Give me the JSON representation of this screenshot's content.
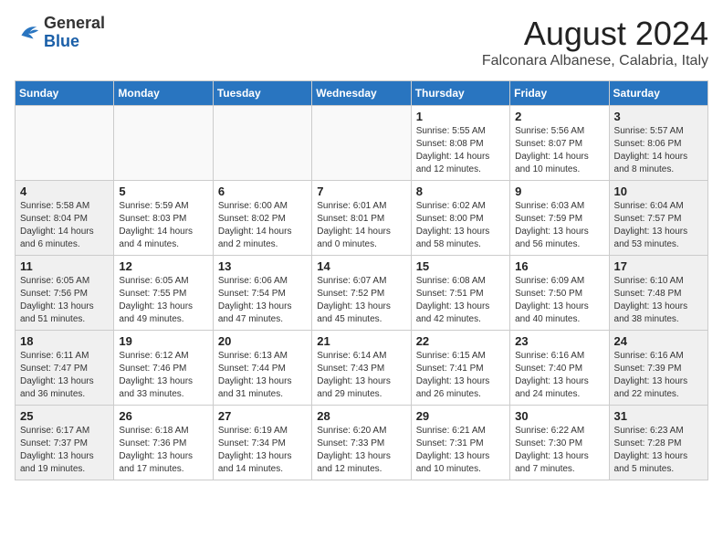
{
  "header": {
    "logo_general": "General",
    "logo_blue": "Blue",
    "month": "August 2024",
    "location": "Falconara Albanese, Calabria, Italy"
  },
  "days_of_week": [
    "Sunday",
    "Monday",
    "Tuesday",
    "Wednesday",
    "Thursday",
    "Friday",
    "Saturday"
  ],
  "weeks": [
    [
      {
        "day": "",
        "info": ""
      },
      {
        "day": "",
        "info": ""
      },
      {
        "day": "",
        "info": ""
      },
      {
        "day": "",
        "info": ""
      },
      {
        "day": "1",
        "info": "Sunrise: 5:55 AM\nSunset: 8:08 PM\nDaylight: 14 hours\nand 12 minutes."
      },
      {
        "day": "2",
        "info": "Sunrise: 5:56 AM\nSunset: 8:07 PM\nDaylight: 14 hours\nand 10 minutes."
      },
      {
        "day": "3",
        "info": "Sunrise: 5:57 AM\nSunset: 8:06 PM\nDaylight: 14 hours\nand 8 minutes."
      }
    ],
    [
      {
        "day": "4",
        "info": "Sunrise: 5:58 AM\nSunset: 8:04 PM\nDaylight: 14 hours\nand 6 minutes."
      },
      {
        "day": "5",
        "info": "Sunrise: 5:59 AM\nSunset: 8:03 PM\nDaylight: 14 hours\nand 4 minutes."
      },
      {
        "day": "6",
        "info": "Sunrise: 6:00 AM\nSunset: 8:02 PM\nDaylight: 14 hours\nand 2 minutes."
      },
      {
        "day": "7",
        "info": "Sunrise: 6:01 AM\nSunset: 8:01 PM\nDaylight: 14 hours\nand 0 minutes."
      },
      {
        "day": "8",
        "info": "Sunrise: 6:02 AM\nSunset: 8:00 PM\nDaylight: 13 hours\nand 58 minutes."
      },
      {
        "day": "9",
        "info": "Sunrise: 6:03 AM\nSunset: 7:59 PM\nDaylight: 13 hours\nand 56 minutes."
      },
      {
        "day": "10",
        "info": "Sunrise: 6:04 AM\nSunset: 7:57 PM\nDaylight: 13 hours\nand 53 minutes."
      }
    ],
    [
      {
        "day": "11",
        "info": "Sunrise: 6:05 AM\nSunset: 7:56 PM\nDaylight: 13 hours\nand 51 minutes."
      },
      {
        "day": "12",
        "info": "Sunrise: 6:05 AM\nSunset: 7:55 PM\nDaylight: 13 hours\nand 49 minutes."
      },
      {
        "day": "13",
        "info": "Sunrise: 6:06 AM\nSunset: 7:54 PM\nDaylight: 13 hours\nand 47 minutes."
      },
      {
        "day": "14",
        "info": "Sunrise: 6:07 AM\nSunset: 7:52 PM\nDaylight: 13 hours\nand 45 minutes."
      },
      {
        "day": "15",
        "info": "Sunrise: 6:08 AM\nSunset: 7:51 PM\nDaylight: 13 hours\nand 42 minutes."
      },
      {
        "day": "16",
        "info": "Sunrise: 6:09 AM\nSunset: 7:50 PM\nDaylight: 13 hours\nand 40 minutes."
      },
      {
        "day": "17",
        "info": "Sunrise: 6:10 AM\nSunset: 7:48 PM\nDaylight: 13 hours\nand 38 minutes."
      }
    ],
    [
      {
        "day": "18",
        "info": "Sunrise: 6:11 AM\nSunset: 7:47 PM\nDaylight: 13 hours\nand 36 minutes."
      },
      {
        "day": "19",
        "info": "Sunrise: 6:12 AM\nSunset: 7:46 PM\nDaylight: 13 hours\nand 33 minutes."
      },
      {
        "day": "20",
        "info": "Sunrise: 6:13 AM\nSunset: 7:44 PM\nDaylight: 13 hours\nand 31 minutes."
      },
      {
        "day": "21",
        "info": "Sunrise: 6:14 AM\nSunset: 7:43 PM\nDaylight: 13 hours\nand 29 minutes."
      },
      {
        "day": "22",
        "info": "Sunrise: 6:15 AM\nSunset: 7:41 PM\nDaylight: 13 hours\nand 26 minutes."
      },
      {
        "day": "23",
        "info": "Sunrise: 6:16 AM\nSunset: 7:40 PM\nDaylight: 13 hours\nand 24 minutes."
      },
      {
        "day": "24",
        "info": "Sunrise: 6:16 AM\nSunset: 7:39 PM\nDaylight: 13 hours\nand 22 minutes."
      }
    ],
    [
      {
        "day": "25",
        "info": "Sunrise: 6:17 AM\nSunset: 7:37 PM\nDaylight: 13 hours\nand 19 minutes."
      },
      {
        "day": "26",
        "info": "Sunrise: 6:18 AM\nSunset: 7:36 PM\nDaylight: 13 hours\nand 17 minutes."
      },
      {
        "day": "27",
        "info": "Sunrise: 6:19 AM\nSunset: 7:34 PM\nDaylight: 13 hours\nand 14 minutes."
      },
      {
        "day": "28",
        "info": "Sunrise: 6:20 AM\nSunset: 7:33 PM\nDaylight: 13 hours\nand 12 minutes."
      },
      {
        "day": "29",
        "info": "Sunrise: 6:21 AM\nSunset: 7:31 PM\nDaylight: 13 hours\nand 10 minutes."
      },
      {
        "day": "30",
        "info": "Sunrise: 6:22 AM\nSunset: 7:30 PM\nDaylight: 13 hours\nand 7 minutes."
      },
      {
        "day": "31",
        "info": "Sunrise: 6:23 AM\nSunset: 7:28 PM\nDaylight: 13 hours\nand 5 minutes."
      }
    ]
  ]
}
